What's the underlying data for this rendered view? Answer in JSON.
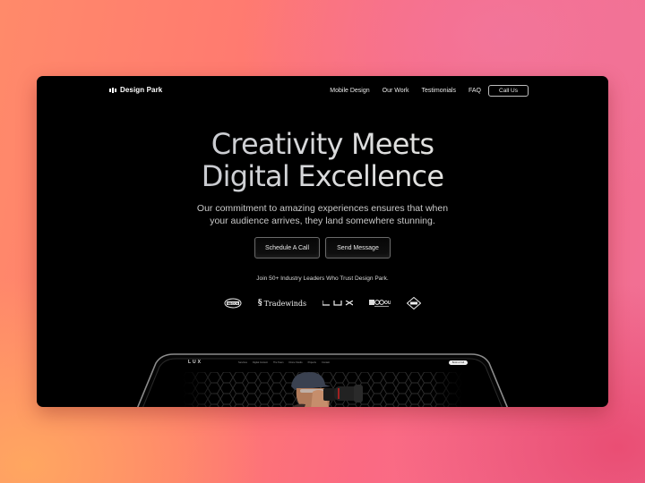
{
  "nav": {
    "brand": "Design Park",
    "links": [
      "Mobile Design",
      "Our Work",
      "Testimonials",
      "FAQ"
    ],
    "cta_label": "Call Us"
  },
  "hero": {
    "title_line1": "Creativity Meets",
    "title_line2": "Digital Excellence",
    "subtitle_line1": "Our commitment to amazing experiences ensures that when",
    "subtitle_line2": "your audience arrives, they land somewhere stunning.",
    "primary_cta": "Schedule A Call",
    "secondary_cta": "Send Message"
  },
  "trust": {
    "text": "Join 50+ Industry Leaders Who Trust Design Park.",
    "logos": [
      "NECCA",
      "Tradewinds",
      "LUX",
      "GO OUT",
      "Diamond emblem"
    ]
  },
  "mockup": {
    "brand": "LUX",
    "links": [
      "Services",
      "Digital Content",
      "The Team",
      "Drone Studio",
      "Projects",
      "Contact"
    ],
    "cta_label": "Book a Call"
  },
  "colors": {
    "frame_background": "#000000",
    "background_gradient": [
      "#ff8a6a",
      "#fb6a82",
      "#f07096"
    ]
  }
}
